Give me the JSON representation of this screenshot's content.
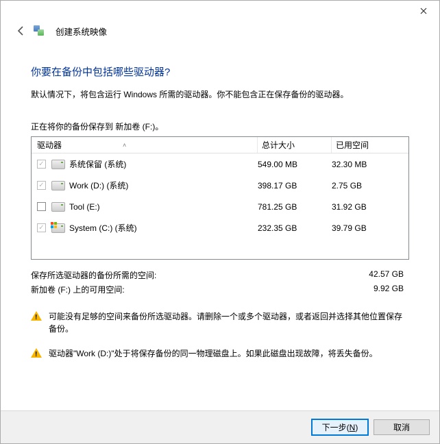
{
  "header": {
    "title": "创建系统映像"
  },
  "main": {
    "question": "你要在备份中包括哪些驱动器?",
    "description": "默认情况下，将包含运行 Windows 所需的驱动器。你不能包含正在保存备份的驱动器。",
    "save_to": "正在将你的备份保存到 新加卷 (F:)。",
    "columns": {
      "drive": "驱动器",
      "total": "总计大小",
      "used": "已用空间"
    },
    "rows": [
      {
        "checked": true,
        "locked": true,
        "win": false,
        "name": "系统保留 (系统)",
        "total": "549.00 MB",
        "used": "32.30 MB"
      },
      {
        "checked": true,
        "locked": true,
        "win": false,
        "name": "Work (D:) (系统)",
        "total": "398.17 GB",
        "used": "2.75 GB"
      },
      {
        "checked": false,
        "locked": false,
        "win": false,
        "name": "Tool (E:)",
        "total": "781.25 GB",
        "used": "31.92 GB"
      },
      {
        "checked": true,
        "locked": true,
        "win": true,
        "name": "System (C:) (系统)",
        "total": "232.35 GB",
        "used": "39.79 GB"
      }
    ],
    "summary": {
      "needed_label": "保存所选驱动器的备份所需的空间:",
      "needed_value": "42.57 GB",
      "avail_label": "新加卷 (F:) 上的可用空间:",
      "avail_value": "9.92 GB"
    },
    "warnings": [
      "可能没有足够的空间来备份所选驱动器。请删除一个或多个驱动器，或者返回并选择其他位置保存备份。",
      "驱动器\"Work (D:)\"处于将保存备份的同一物理磁盘上。如果此磁盘出现故障，将丢失备份。"
    ]
  },
  "footer": {
    "next_prefix": "下一步(",
    "next_key": "N",
    "next_suffix": ")",
    "cancel": "取消"
  }
}
